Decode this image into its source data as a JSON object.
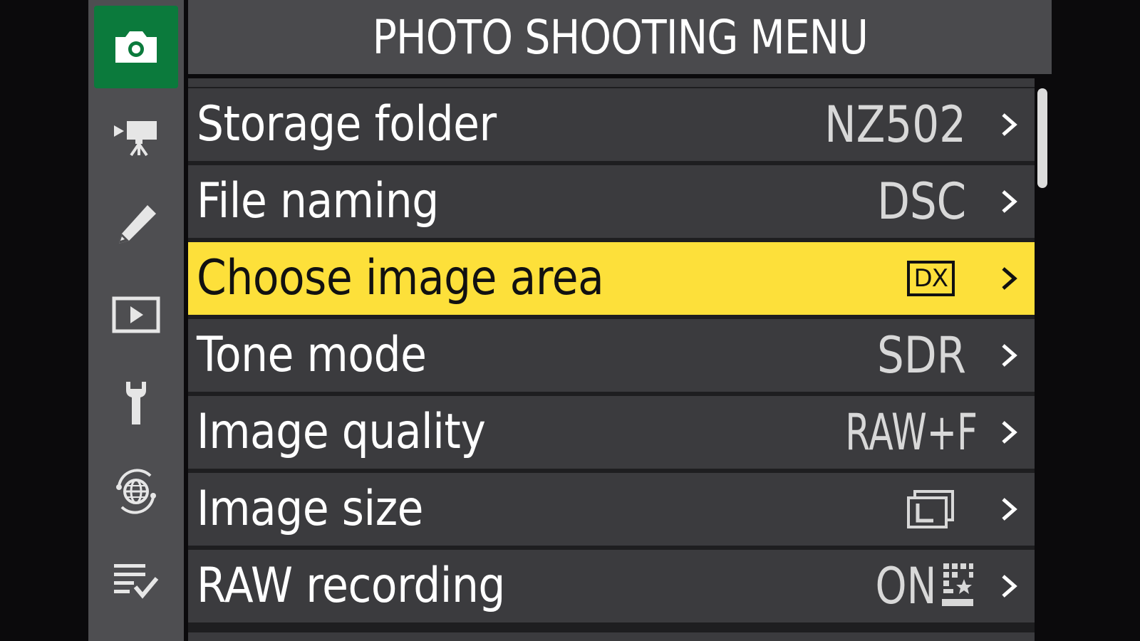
{
  "header": {
    "title": "PHOTO SHOOTING MENU"
  },
  "tabs": [
    {
      "name": "photo-shooting",
      "icon": "camera-icon",
      "active": true
    },
    {
      "name": "video-recording",
      "icon": "movie-camera-icon",
      "active": false
    },
    {
      "name": "custom-settings",
      "icon": "pencil-icon",
      "active": false
    },
    {
      "name": "playback",
      "icon": "playback-icon",
      "active": false
    },
    {
      "name": "setup",
      "icon": "wrench-icon",
      "active": false
    },
    {
      "name": "network",
      "icon": "network-globe-icon",
      "active": false
    },
    {
      "name": "my-menu",
      "icon": "my-menu-checklist-icon",
      "active": false
    }
  ],
  "menu": {
    "items": [
      {
        "label": "Storage folder",
        "value": "NZ502",
        "value_type": "text",
        "selected": false
      },
      {
        "label": "File naming",
        "value": "DSC",
        "value_type": "text",
        "selected": false
      },
      {
        "label": "Choose image area",
        "value": "DX",
        "value_type": "boxed-icon",
        "selected": true
      },
      {
        "label": "Tone mode",
        "value": "SDR",
        "value_type": "text",
        "selected": false
      },
      {
        "label": "Image quality",
        "value": "RAW+F",
        "value_type": "text",
        "selected": false
      },
      {
        "label": "Image size",
        "value": "",
        "value_type": "image-size-large-icon",
        "selected": false
      },
      {
        "label": "RAW recording",
        "value": "ON",
        "value_type": "text-with-icon",
        "selected": false
      }
    ]
  },
  "colors": {
    "accent_active_tab": "#0b7a3c",
    "selected_row": "#fde03a",
    "row_bg": "#3b3b3e",
    "header_bg": "#4a4a4d"
  }
}
